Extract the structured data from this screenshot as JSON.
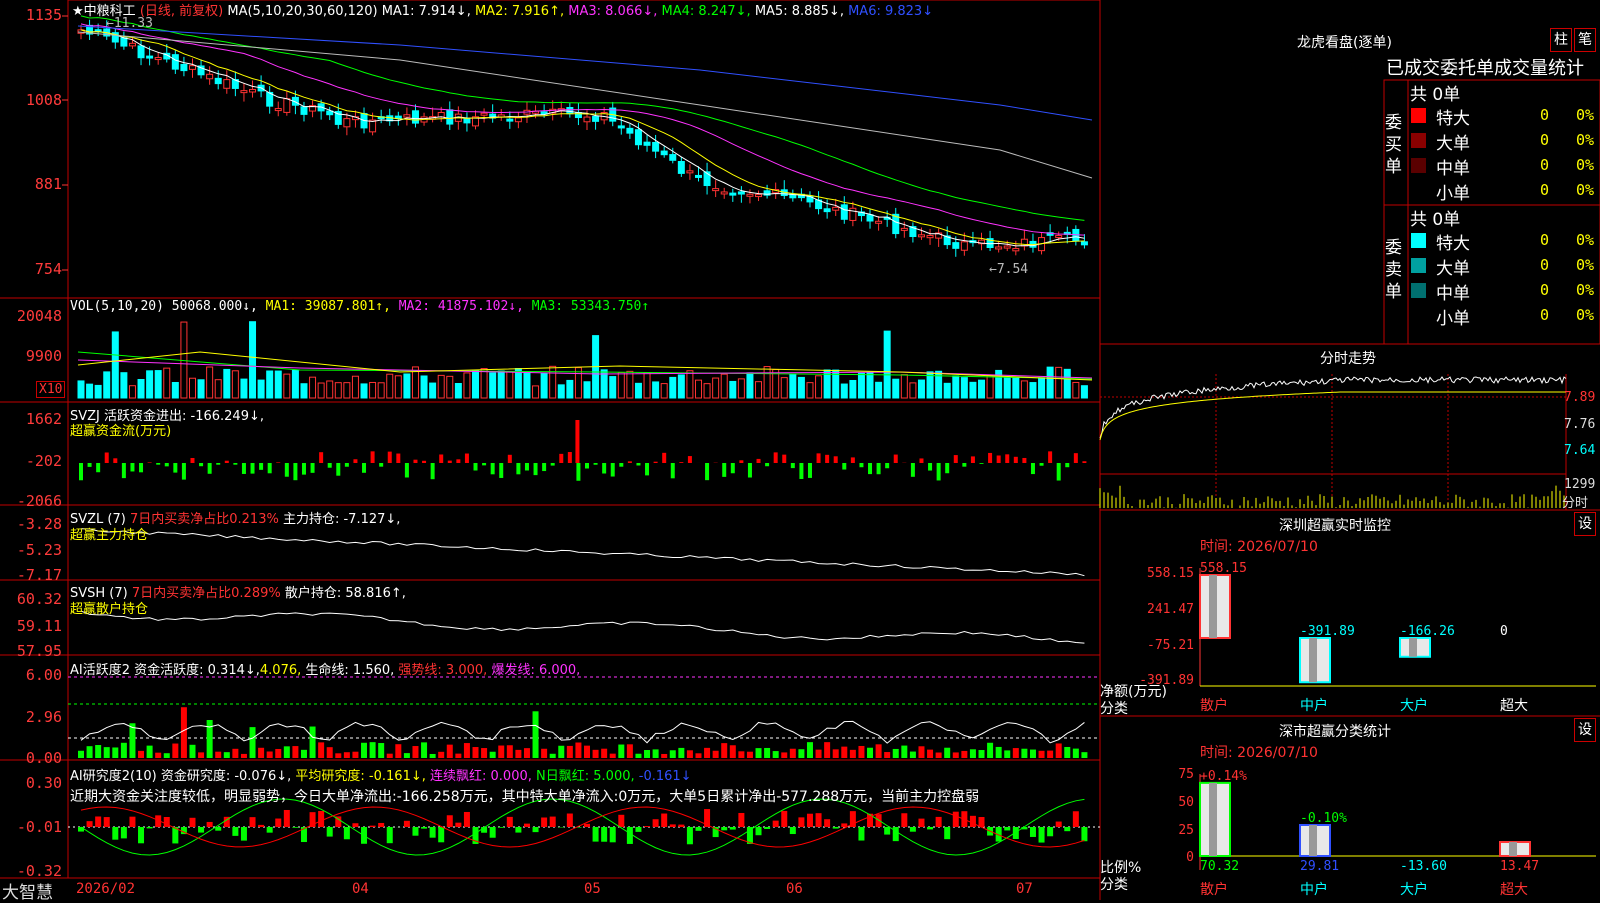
{
  "header": {
    "star": "★",
    "stock_name": "中粮科工",
    "mode": "(日线, 前复权)",
    "ma_params": "MA(5,10,20,30,60,120)",
    "ma1": "MA1: 7.914↓,",
    "ma2": "MA2: 7.916↑,",
    "ma3": "MA3: 8.066↓,",
    "ma4": "MA4: 8.247↓,",
    "ma5": "MA5: 8.885↓,",
    "ma6": "MA6: 9.823↓",
    "high_note": "←11.33",
    "low_note": "←7.54"
  },
  "price_axis": [
    "1135",
    "1008",
    "881",
    "754"
  ],
  "vol": {
    "label": "VOL(5,10,20)",
    "value": "50068.000↓,",
    "ma1": "MA1: 39087.801↑,",
    "ma2": "MA2: 41875.102↓,",
    "ma3": "MA3: 53343.750↑",
    "axis": [
      "20048",
      "9900"
    ],
    "unit": "X10"
  },
  "svzj": {
    "label": "SVZJ  活跃资金进出: -166.249↓,",
    "sub": "超赢资金流(万元)",
    "axis": [
      "1662",
      "-202",
      "-2066"
    ]
  },
  "svzl": {
    "label": "SVZL (7)",
    "red": "7日内买卖净占比0.213%",
    "rest": "主力持仓: -7.127↓,",
    "sub": "超赢主力持仓",
    "axis": [
      "-3.28",
      "-5.23",
      "-7.17"
    ]
  },
  "svsh": {
    "label": "SVSH (7)",
    "red": "7日内买卖净占比0.289%",
    "rest": "散户持仓: 58.816↑,",
    "sub": "超赢散户持仓",
    "axis": [
      "60.32",
      "59.11",
      "57.95"
    ]
  },
  "ai1": {
    "label": "AI活跃度2",
    "a": "资金活跃度: 0.314↓,",
    "b": "4.076,",
    "c": "生命线: 1.560,",
    "d": "强势线: 3.000,",
    "e": "爆发线: 6.000,",
    "axis": [
      "6.00",
      "2.96",
      "0.00"
    ]
  },
  "ai2": {
    "label": "AI研究度2(10)",
    "a": "资金研究度: -0.076↓,",
    "b": "平均研究度: -0.161↓,",
    "c": "连续飘红: 0.000,",
    "d": "N日飘红: 5.000,",
    "e": "-0.161↓",
    "commentary": "近期大资金关注度较低，明显弱势，今日大单净流出:-166.258万元，其中特大单净流入:0万元，大单5日累计净出-577.288万元，当前主力控盘弱",
    "axis": [
      "0.30",
      "-0.01",
      "-0.32"
    ]
  },
  "footer": {
    "brand": "大智慧",
    "dates": [
      "2026/02",
      "04",
      "05",
      "06",
      "07"
    ]
  },
  "longhu": {
    "title": "龙虎看盘(逐单)",
    "btn1": "柱",
    "btn2": "笔",
    "subtitle": "已成交委托单成交量统计",
    "buy": {
      "header": "共 0单",
      "side_label": "委买单",
      "rows": [
        {
          "name": "特大",
          "count": "0",
          "pct": "0%",
          "color": "#ff0000"
        },
        {
          "name": "大单",
          "count": "0",
          "pct": "0%",
          "color": "#8b0000"
        },
        {
          "name": "中单",
          "count": "0",
          "pct": "0%",
          "color": "#5a0000"
        },
        {
          "name": "小单",
          "count": "0",
          "pct": "0%",
          "color": ""
        }
      ]
    },
    "sell": {
      "header": "共 0单",
      "side_label": "委卖单",
      "rows": [
        {
          "name": "特大",
          "count": "0",
          "pct": "0%",
          "color": "#00ffff"
        },
        {
          "name": "大单",
          "count": "0",
          "pct": "0%",
          "color": "#00a0a0"
        },
        {
          "name": "中单",
          "count": "0",
          "pct": "0%",
          "color": "#007070"
        },
        {
          "name": "小单",
          "count": "0",
          "pct": "0%",
          "color": ""
        }
      ]
    }
  },
  "intraday": {
    "title": "分时走势",
    "axis": [
      "7.89",
      "7.76",
      "7.64"
    ],
    "vol_label": "1299",
    "vol_unit": "分时"
  },
  "sz_monitor": {
    "title": "深圳超赢实时监控",
    "settings": "设",
    "time": "时间: 2026/07/10",
    "axis": [
      "558.15",
      "241.47",
      "-75.21",
      "-391.89"
    ],
    "y_label": "净额(万元)",
    "x_label": "分类",
    "chart_data": {
      "type": "bar",
      "categories": [
        "散户",
        "中户",
        "大户",
        "超大"
      ],
      "values": [
        558.15,
        -391.89,
        -166.26,
        0
      ],
      "value_labels": [
        "558.15",
        "-391.89",
        "-166.26",
        "0"
      ],
      "ylim": [
        -391.89,
        558.15
      ]
    }
  },
  "sz_stats": {
    "title": "深市超赢分类统计",
    "settings": "设",
    "time": "时间: 2026/07/10",
    "axis": [
      "75",
      "50",
      "25",
      "0"
    ],
    "y_label": "比例%",
    "x_label": "分类",
    "chart_data": {
      "type": "bar",
      "categories": [
        "散户",
        "中户",
        "大户",
        "超大"
      ],
      "values": [
        70.32,
        29.81,
        -13.6,
        13.47
      ],
      "value_labels": [
        "70.32",
        "29.81",
        "-13.60",
        "13.47"
      ],
      "top_labels": [
        "+0.14%",
        "-0.10%",
        "",
        ""
      ],
      "ylim": [
        0,
        75
      ]
    }
  },
  "colors": {
    "up": "#ff3333",
    "down": "#00ffff",
    "grid": "#c00000",
    "ma1": "#ffffff",
    "ma2": "#ffff00",
    "ma3": "#ff33ff",
    "ma4": "#00ff00",
    "ma5": "#bbbbbb",
    "ma6": "#3050ff"
  }
}
